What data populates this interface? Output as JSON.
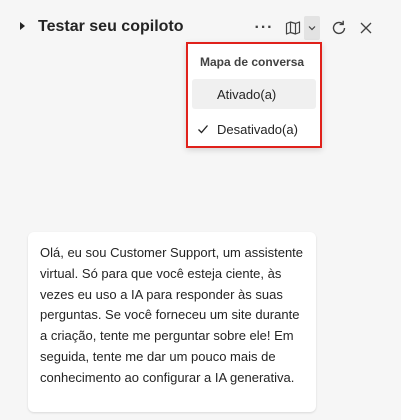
{
  "header": {
    "title": "Testar seu copiloto",
    "more_icon": "more-horizontal-icon",
    "map_icon": "map-icon",
    "refresh_icon": "refresh-icon",
    "close_icon": "close-icon"
  },
  "dropdown": {
    "heading": "Mapa de conversa",
    "options": [
      {
        "label": "Ativado(a)",
        "selected": false
      },
      {
        "label": "Desativado(a)",
        "selected": true
      }
    ],
    "highlight_color": "#e0211b"
  },
  "message": {
    "text": "Olá, eu sou Customer Support, um assistente virtual. Só para que você esteja ciente, às vezes eu uso a IA para responder às suas perguntas. Se você forneceu um site durante a criação, tente me perguntar sobre ele! Em seguida, tente me dar um pouco mais de conhecimento ao configurar a IA generativa."
  }
}
